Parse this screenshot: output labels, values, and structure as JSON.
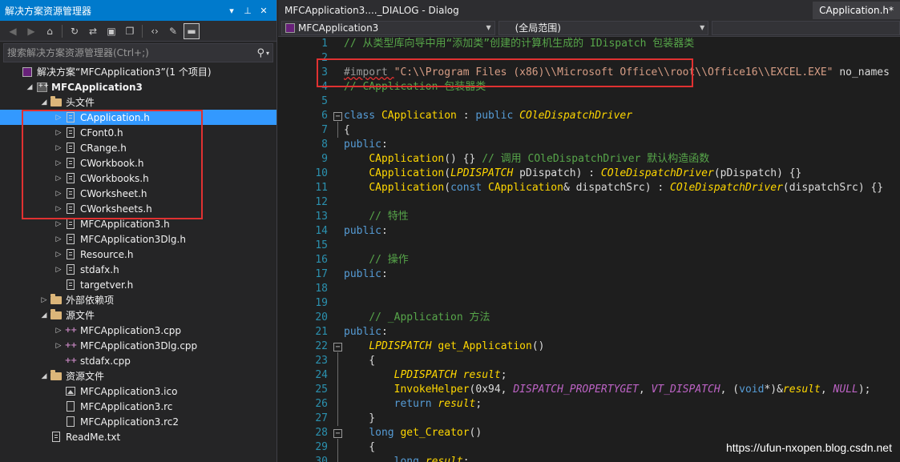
{
  "solution_explorer": {
    "title": "解决方案资源管理器",
    "title_buttons": [
      "▾",
      "⊥",
      "✕"
    ],
    "search_placeholder": "搜索解决方案资源管理器(Ctrl+;)",
    "tree": [
      {
        "label": "解决方案“MFCApplication3”(1 个项目)",
        "level": 0,
        "icon": "solution-icon",
        "arrow": ""
      },
      {
        "label": "MFCApplication3",
        "level": 1,
        "icon": "project-icon",
        "arrow": "◢",
        "bold": true
      },
      {
        "label": "头文件",
        "level": 2,
        "icon": "folder-icon",
        "arrow": "◢"
      },
      {
        "label": "CApplication.h",
        "level": 3,
        "icon": "header-file-icon",
        "arrow": "▷",
        "selected": true
      },
      {
        "label": "CFont0.h",
        "level": 3,
        "icon": "header-file-icon",
        "arrow": "▷"
      },
      {
        "label": "CRange.h",
        "level": 3,
        "icon": "header-file-icon",
        "arrow": "▷"
      },
      {
        "label": "CWorkbook.h",
        "level": 3,
        "icon": "header-file-icon",
        "arrow": "▷"
      },
      {
        "label": "CWorkbooks.h",
        "level": 3,
        "icon": "header-file-icon",
        "arrow": "▷"
      },
      {
        "label": "CWorksheet.h",
        "level": 3,
        "icon": "header-file-icon",
        "arrow": "▷"
      },
      {
        "label": "CWorksheets.h",
        "level": 3,
        "icon": "header-file-icon",
        "arrow": "▷"
      },
      {
        "label": "MFCApplication3.h",
        "level": 3,
        "icon": "header-file-icon",
        "arrow": "▷"
      },
      {
        "label": "MFCApplication3Dlg.h",
        "level": 3,
        "icon": "header-file-icon",
        "arrow": "▷"
      },
      {
        "label": "Resource.h",
        "level": 3,
        "icon": "header-file-icon",
        "arrow": "▷"
      },
      {
        "label": "stdafx.h",
        "level": 3,
        "icon": "header-file-icon",
        "arrow": "▷"
      },
      {
        "label": "targetver.h",
        "level": 3,
        "icon": "header-file-icon",
        "arrow": ""
      },
      {
        "label": "外部依赖项",
        "level": 2,
        "icon": "folder-icon",
        "arrow": "▷"
      },
      {
        "label": "源文件",
        "level": 2,
        "icon": "folder-icon",
        "arrow": "◢"
      },
      {
        "label": "MFCApplication3.cpp",
        "level": 3,
        "icon": "cpp-file-icon",
        "arrow": "▷"
      },
      {
        "label": "MFCApplication3Dlg.cpp",
        "level": 3,
        "icon": "cpp-file-icon",
        "arrow": "▷"
      },
      {
        "label": "stdafx.cpp",
        "level": 3,
        "icon": "cpp-file-icon",
        "arrow": ""
      },
      {
        "label": "资源文件",
        "level": 2,
        "icon": "folder-icon",
        "arrow": "◢"
      },
      {
        "label": "MFCApplication3.ico",
        "level": 3,
        "icon": "image-file-icon",
        "arrow": ""
      },
      {
        "label": "MFCApplication3.rc",
        "level": 3,
        "icon": "resource-file-icon",
        "arrow": ""
      },
      {
        "label": "MFCApplication3.rc2",
        "level": 3,
        "icon": "resource-file-icon",
        "arrow": ""
      },
      {
        "label": "ReadMe.txt",
        "level": 2,
        "icon": "text-file-icon",
        "arrow": ""
      }
    ]
  },
  "editor": {
    "tab_left": "MFCApplication3...._DIALOG - Dialog",
    "tab_right": "CApplication.h*",
    "scope_combo": "MFCApplication3",
    "member_combo": "(全局范围)",
    "lines": [
      {
        "n": "1",
        "tokens": [
          [
            "cm",
            "// 从类型库向导中用“添加类”创建的计算机生成的 IDispatch 包装器类"
          ]
        ]
      },
      {
        "n": "2",
        "tokens": []
      },
      {
        "n": "3",
        "tokens": [
          [
            "pre",
            "#import "
          ],
          [
            "str",
            "\"C:\\\\Program Files (x86)\\\\Microsoft Office\\\\root\\\\Office16\\\\EXCEL.EXE\""
          ],
          [
            "pl",
            " no_names"
          ]
        ]
      },
      {
        "n": "4",
        "tokens": [
          [
            "cm",
            "// CApplication 包装器类"
          ]
        ]
      },
      {
        "n": "5",
        "tokens": []
      },
      {
        "n": "6",
        "fold": "−",
        "tokens": [
          [
            "kw",
            "class"
          ],
          [
            "pl",
            " "
          ],
          [
            "cls",
            "CApplication"
          ],
          [
            "pl",
            " : "
          ],
          [
            "kw",
            "public"
          ],
          [
            "pl",
            " "
          ],
          [
            "it",
            "COleDispatchDriver"
          ]
        ]
      },
      {
        "n": "7",
        "tokens": [
          [
            "pl",
            "{"
          ]
        ]
      },
      {
        "n": "8",
        "tokens": [
          [
            "kw",
            "public"
          ],
          [
            "pl",
            ":"
          ]
        ]
      },
      {
        "n": "9",
        "tokens": [
          [
            "pl",
            "    "
          ],
          [
            "fn",
            "CApplication"
          ],
          [
            "pl",
            "() {} "
          ],
          [
            "cm",
            "// 调用 COleDispatchDriver 默认构造函数"
          ]
        ]
      },
      {
        "n": "10",
        "tokens": [
          [
            "pl",
            "    "
          ],
          [
            "fn",
            "CApplication"
          ],
          [
            "pl",
            "("
          ],
          [
            "it",
            "LPDISPATCH"
          ],
          [
            "pl",
            " pDispatch) : "
          ],
          [
            "it",
            "COleDispatchDriver"
          ],
          [
            "pl",
            "(pDispatch) {}"
          ]
        ]
      },
      {
        "n": "11",
        "tokens": [
          [
            "pl",
            "    "
          ],
          [
            "fn",
            "CApplication"
          ],
          [
            "pl",
            "("
          ],
          [
            "kw",
            "const"
          ],
          [
            "pl",
            " "
          ],
          [
            "cls",
            "CApplication"
          ],
          [
            "pl",
            "& dispatchSrc) : "
          ],
          [
            "it",
            "COleDispatchDriver"
          ],
          [
            "pl",
            "(dispatchSrc) {}"
          ]
        ]
      },
      {
        "n": "12",
        "tokens": []
      },
      {
        "n": "13",
        "tokens": [
          [
            "pl",
            "    "
          ],
          [
            "cm",
            "// 特性"
          ]
        ]
      },
      {
        "n": "14",
        "tokens": [
          [
            "kw",
            "public"
          ],
          [
            "pl",
            ":"
          ]
        ]
      },
      {
        "n": "15",
        "tokens": []
      },
      {
        "n": "16",
        "tokens": [
          [
            "pl",
            "    "
          ],
          [
            "cm",
            "// 操作"
          ]
        ]
      },
      {
        "n": "17",
        "tokens": [
          [
            "kw",
            "public"
          ],
          [
            "pl",
            ":"
          ]
        ]
      },
      {
        "n": "18",
        "tokens": []
      },
      {
        "n": "19",
        "tokens": []
      },
      {
        "n": "20",
        "tokens": [
          [
            "pl",
            "    "
          ],
          [
            "cm",
            "// _Application 方法"
          ]
        ]
      },
      {
        "n": "21",
        "tokens": [
          [
            "kw",
            "public"
          ],
          [
            "pl",
            ":"
          ]
        ]
      },
      {
        "n": "22",
        "fold": "−",
        "tokens": [
          [
            "pl",
            "    "
          ],
          [
            "it",
            "LPDISPATCH"
          ],
          [
            "pl",
            " "
          ],
          [
            "fn",
            "get_Application"
          ],
          [
            "pl",
            "()"
          ]
        ]
      },
      {
        "n": "23",
        "tokens": [
          [
            "pl",
            "    {"
          ]
        ]
      },
      {
        "n": "24",
        "tokens": [
          [
            "pl",
            "        "
          ],
          [
            "it",
            "LPDISPATCH"
          ],
          [
            "pl",
            " "
          ],
          [
            "var",
            "result"
          ],
          [
            "pl",
            ";"
          ]
        ]
      },
      {
        "n": "25",
        "tokens": [
          [
            "pl",
            "        "
          ],
          [
            "fn",
            "InvokeHelper"
          ],
          [
            "pl",
            "(0x94, "
          ],
          [
            "mac",
            "DISPATCH_PROPERTYGET"
          ],
          [
            "pl",
            ", "
          ],
          [
            "mac",
            "VT_DISPATCH"
          ],
          [
            "pl",
            ", ("
          ],
          [
            "kw",
            "void"
          ],
          [
            "pl",
            "*)&"
          ],
          [
            "var",
            "result"
          ],
          [
            "pl",
            ", "
          ],
          [
            "mac",
            "NULL"
          ],
          [
            "pl",
            ");"
          ]
        ]
      },
      {
        "n": "26",
        "tokens": [
          [
            "pl",
            "        "
          ],
          [
            "kw",
            "return"
          ],
          [
            "pl",
            " "
          ],
          [
            "var",
            "result"
          ],
          [
            "pl",
            ";"
          ]
        ]
      },
      {
        "n": "27",
        "tokens": [
          [
            "pl",
            "    }"
          ]
        ]
      },
      {
        "n": "28",
        "fold": "−",
        "tokens": [
          [
            "pl",
            "    "
          ],
          [
            "kw",
            "long"
          ],
          [
            "pl",
            " "
          ],
          [
            "fn",
            "get_Creator"
          ],
          [
            "pl",
            "()"
          ]
        ]
      },
      {
        "n": "29",
        "tokens": [
          [
            "pl",
            "    {"
          ]
        ]
      },
      {
        "n": "30",
        "tokens": [
          [
            "pl",
            "        "
          ],
          [
            "kw",
            "long"
          ],
          [
            "pl",
            " "
          ],
          [
            "var",
            "result"
          ],
          [
            "pl",
            ";"
          ]
        ]
      }
    ]
  },
  "watermark": "https://ufun-nxopen.blog.csdn.net"
}
